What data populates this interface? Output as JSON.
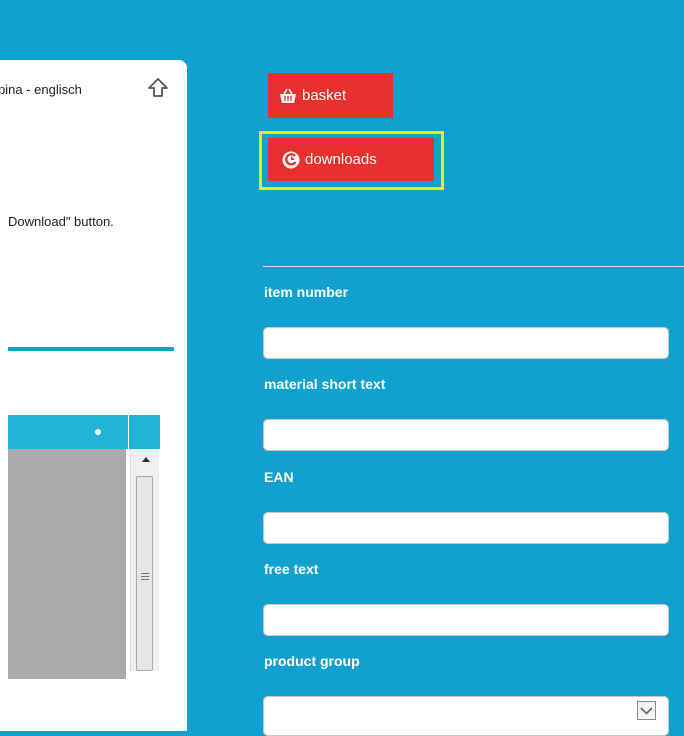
{
  "left_panel": {
    "title": "pina - englisch",
    "hint": "Download\" button.",
    "table": {
      "header_indicator": "•"
    }
  },
  "actions": {
    "basket_label": "basket",
    "downloads_label": "downloads"
  },
  "filters": {
    "item_number": {
      "label": "item number",
      "value": ""
    },
    "material_short_text": {
      "label": "material short text",
      "value": ""
    },
    "ean": {
      "label": "EAN",
      "value": ""
    },
    "free_text": {
      "label": "free text",
      "value": ""
    },
    "product_group": {
      "label": "product group",
      "selected": ""
    }
  },
  "colors": {
    "background": "#12a0cf",
    "button": "#e8302f",
    "highlight": "#e8ec1c"
  },
  "icons": {
    "home": "home-icon",
    "basket": "basket-icon",
    "downloads": "downloads-icon",
    "dropdown": "chevron-down-icon"
  }
}
